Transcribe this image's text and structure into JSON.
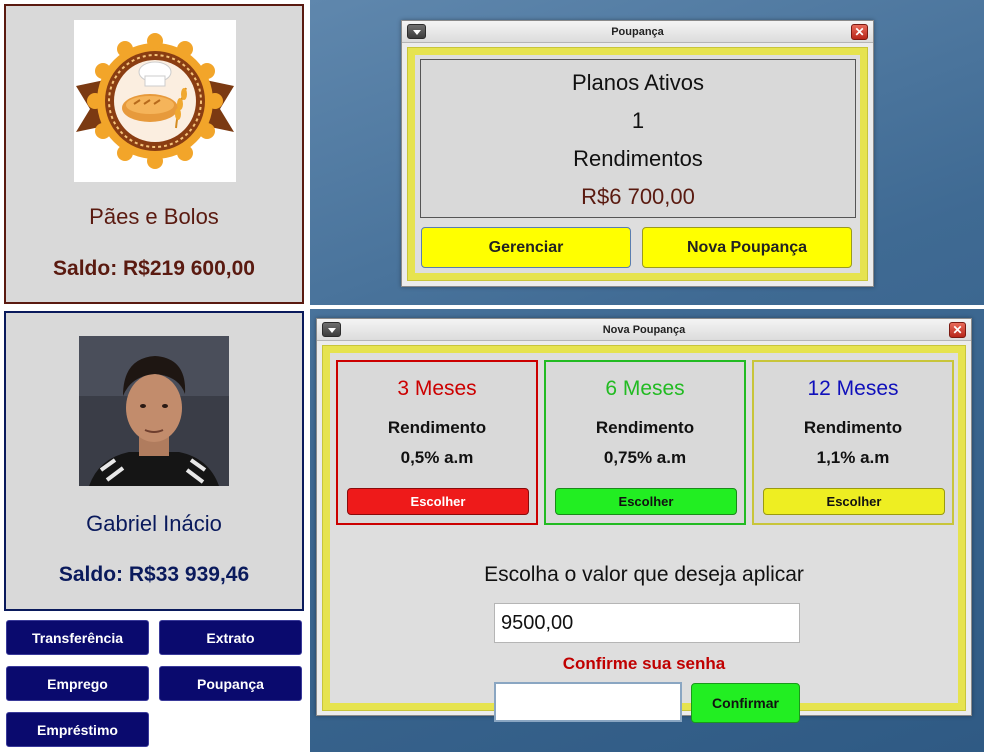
{
  "colors": {
    "company_accent": "#5a1a10",
    "user_accent": "#0a1a5c",
    "nav_button_bg": "#0a0a6e",
    "yellow_frame": "#e6e34f",
    "yellow_button": "#ffff00",
    "plan_3_color": "#cc0000",
    "plan_6_color": "#22bb22",
    "plan_12_color": "#1010bb",
    "plan_3_button": "#ee1a1a",
    "plan_6_button": "#22ee22",
    "plan_12_button": "#eeee22",
    "confirm_label_color": "#c00000",
    "confirm_button": "#22ee22"
  },
  "company": {
    "name": "Pães e Bolos",
    "saldo": "Saldo: R$219 600,00",
    "logo_icon": "bakery-badge-logo"
  },
  "user": {
    "name": "Gabriel Inácio",
    "saldo": "Saldo: R$33 939,46",
    "avatar": "profile-photo"
  },
  "nav": {
    "transferencia": "Transferência",
    "extrato": "Extrato",
    "emprego": "Emprego",
    "poupanca": "Poupança",
    "emprestimo": "Empréstimo"
  },
  "poupanca_window": {
    "title": "Poupança",
    "close_glyph": "✕",
    "planos_label": "Planos Ativos",
    "planos_count": "1",
    "rendimentos_label": "Rendimentos",
    "rendimentos_value": "R$6 700,00",
    "gerenciar_label": "Gerenciar",
    "nova_label": "Nova Poupança"
  },
  "nova_window": {
    "title": "Nova Poupança",
    "close_glyph": "✕",
    "plans": [
      {
        "title": "3 Meses",
        "label": "Rendimento",
        "rate": "0,5% a.m",
        "button": "Escolher"
      },
      {
        "title": "6 Meses",
        "label": "Rendimento",
        "rate": "0,75% a.m",
        "button": "Escolher"
      },
      {
        "title": "12 Meses",
        "label": "Rendimento",
        "rate": "1,1% a.m",
        "button": "Escolher"
      }
    ],
    "prompt": "Escolha o valor que deseja aplicar",
    "value": "9500,00",
    "confirm_label": "Confirme sua senha",
    "password": "",
    "confirm_button": "Confirmar"
  }
}
